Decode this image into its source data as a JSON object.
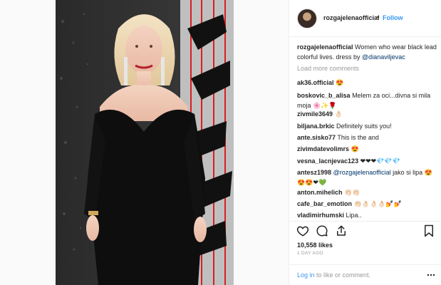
{
  "post": {
    "username": "rozgajelenaofficial",
    "follow_label": "Follow",
    "separator": "•",
    "caption_text": "Women who wear black lead colorful lives. dress by ",
    "caption_mention": "@dianaviljevac",
    "load_more": "Load more comments",
    "comments": [
      {
        "user": "ak36.official",
        "text": "😍"
      },
      {
        "user": "boskovic_b_alisa",
        "text": "Melem za oci...divna si mila moja 🌸✨🌹"
      },
      {
        "user": "zivmile3649",
        "text": "👌🏻"
      },
      {
        "user": "biljana.brkic",
        "text": "Definitely suits you!"
      },
      {
        "user": "ante.sisko77",
        "text": "This is the and"
      },
      {
        "user": "zivimdatevolimrs",
        "text": "😍"
      },
      {
        "user": "vesna_lacnjevac123",
        "text": "❤❤❤💎💎💎"
      },
      {
        "user": "antesz1998",
        "mention": "@rozgajelenaofficial",
        "text": " jako si lipa 😍😍😍❤💚"
      },
      {
        "user": "anton.mihelich",
        "text": "👏🏻👏🏻"
      },
      {
        "user": "cafe_bar_emotion",
        "text": "👏🏻👌🏻👌🏻👌🏻💅💅"
      },
      {
        "user": "vladimirhumski",
        "text": "Lipa.."
      }
    ],
    "likes": "10,558 likes",
    "date": "1 DAY AGO",
    "footer": {
      "login": "Log in",
      "rest": " to like or comment."
    }
  },
  "icons": {
    "like": "heart-icon",
    "comment": "comment-icon",
    "share": "share-icon",
    "save": "bookmark-icon",
    "more": "more-options-icon"
  },
  "colors": {
    "link": "#3897f0",
    "mention": "#003569",
    "muted": "#999999"
  }
}
